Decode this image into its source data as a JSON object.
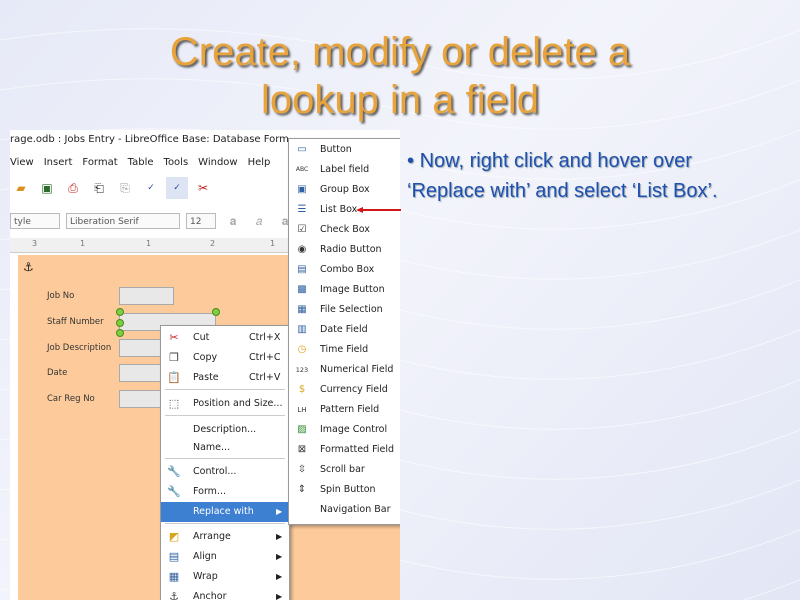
{
  "slide": {
    "title_line1": "Create, modify or delete a",
    "title_line2": "lookup in a field",
    "bullet_mark": "•",
    "bullet_text": "Now, right click and hover over ‘Replace with’ and select ‘List Box’."
  },
  "window": {
    "title": "rage.odb : Jobs Entry - LibreOffice Base: Database Form"
  },
  "menubar": [
    "View",
    "Insert",
    "Format",
    "Table",
    "Tools",
    "Window",
    "Help"
  ],
  "fontbar": {
    "style": "tyle",
    "font": "Liberation Serif",
    "size": "12"
  },
  "ruler": [
    "3",
    "1",
    "1",
    "2",
    "1",
    "3"
  ],
  "form_fields": [
    {
      "label": "Job No"
    },
    {
      "label": "Staff Number"
    },
    {
      "label": "Job Description"
    },
    {
      "label": "Date"
    },
    {
      "label": "Car Reg No"
    }
  ],
  "context_menu": [
    {
      "label": "Cut",
      "shortcut": "Ctrl+X",
      "icon": "scissors-icon"
    },
    {
      "label": "Copy",
      "shortcut": "Ctrl+C",
      "icon": "copy-icon"
    },
    {
      "label": "Paste",
      "shortcut": "Ctrl+V",
      "icon": "paste-icon"
    },
    {
      "label": "Position and Size...",
      "shortcut": "",
      "icon": "position-icon"
    },
    {
      "label": "Description...",
      "shortcut": "",
      "icon": ""
    },
    {
      "label": "Name...",
      "shortcut": "",
      "icon": ""
    },
    {
      "label": "Control...",
      "shortcut": "",
      "icon": "control-icon"
    },
    {
      "label": "Form...",
      "shortcut": "",
      "icon": "form-icon"
    },
    {
      "label": "Replace with",
      "shortcut": "",
      "icon": ""
    },
    {
      "label": "Arrange",
      "shortcut": "",
      "icon": "arrange-icon"
    },
    {
      "label": "Align",
      "shortcut": "",
      "icon": "align-icon"
    },
    {
      "label": "Wrap",
      "shortcut": "",
      "icon": "wrap-icon"
    },
    {
      "label": "Anchor",
      "shortcut": "",
      "icon": "anchor-icon"
    }
  ],
  "submenu": [
    {
      "label": "Button",
      "icon": "button-icon"
    },
    {
      "label": "Label field",
      "icon": "abc-icon"
    },
    {
      "label": "Group Box",
      "icon": "groupbox-icon"
    },
    {
      "label": "List Box",
      "icon": "listbox-icon"
    },
    {
      "label": "Check Box",
      "icon": "checkbox-icon"
    },
    {
      "label": "Radio Button",
      "icon": "radio-icon"
    },
    {
      "label": "Combo Box",
      "icon": "combobox-icon"
    },
    {
      "label": "Image Button",
      "icon": "imagebutton-icon"
    },
    {
      "label": "File Selection",
      "icon": "fileselection-icon"
    },
    {
      "label": "Date Field",
      "icon": "datefield-icon"
    },
    {
      "label": "Time Field",
      "icon": "timefield-icon"
    },
    {
      "label": "Numerical Field",
      "icon": "numerical-icon"
    },
    {
      "label": "Currency Field",
      "icon": "currency-icon"
    },
    {
      "label": "Pattern Field",
      "icon": "pattern-icon"
    },
    {
      "label": "Image Control",
      "icon": "imagecontrol-icon"
    },
    {
      "label": "Formatted Field",
      "icon": "formatted-icon"
    },
    {
      "label": "Scroll bar",
      "icon": "scrollbar-icon"
    },
    {
      "label": "Spin Button",
      "icon": "spinbutton-icon"
    },
    {
      "label": "Navigation Bar",
      "icon": ""
    }
  ],
  "colors": {
    "title": "#e8a33a",
    "bullet": "#1f4fb0",
    "form_bg": "#fdcb9b",
    "highlight": "#3d7fd1",
    "arrow": "#d01818"
  }
}
